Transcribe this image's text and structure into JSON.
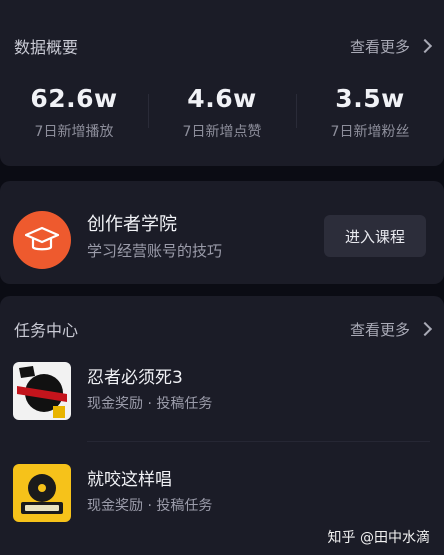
{
  "data_overview": {
    "title": "数据概要",
    "more": "查看更多",
    "stats": [
      {
        "value": "62.6w",
        "label": "7日新增播放"
      },
      {
        "value": "4.6w",
        "label": "7日新增点赞"
      },
      {
        "value": "3.5w",
        "label": "7日新增粉丝"
      }
    ]
  },
  "course": {
    "title": "创作者学院",
    "subtitle": "学习经营账号的技巧",
    "button": "进入课程"
  },
  "tasks": {
    "title": "任务中心",
    "more": "查看更多",
    "items": [
      {
        "name": "忍者必须死3",
        "sub": "现金奖励 · 投稿任务"
      },
      {
        "name": "就咬这样唱",
        "sub": "现金奖励 · 投稿任务"
      }
    ]
  },
  "watermark": "知乎 @田中水滴"
}
